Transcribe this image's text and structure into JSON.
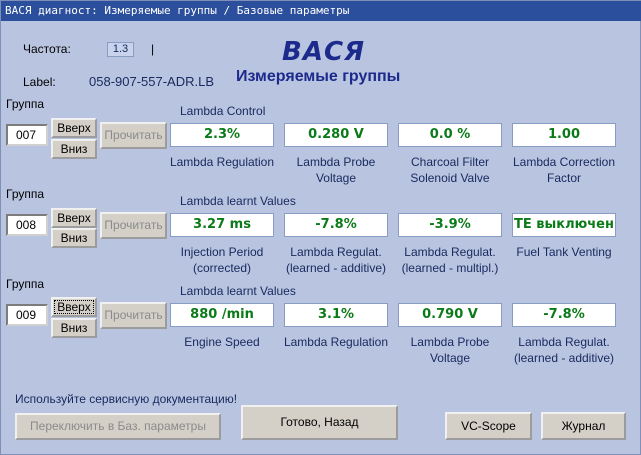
{
  "window": {
    "title": "ВАСЯ диагност: Измеряемые группы / Базовые параметры"
  },
  "header": {
    "freq_label": "Частота:",
    "freq_value": "1.3",
    "freq_unit": "|",
    "label_label": "Label:",
    "label_value": "058-907-557-ADR.LB",
    "brand": "ВАСЯ",
    "subtitle": "Измеряемые группы"
  },
  "groups": [
    {
      "group_label": "Группа",
      "number": "007",
      "up_label": "Вверх",
      "down_label": "Вниз",
      "read_label": "Прочитать",
      "section_title": "Lambda Control",
      "fields": [
        {
          "value": "2.3%",
          "desc": "Lambda Regulation"
        },
        {
          "value": "0.280 V",
          "desc": "Lambda Probe Voltage"
        },
        {
          "value": "0.0 %",
          "desc": "Charcoal Filter Solenoid Valve"
        },
        {
          "value": "1.00",
          "desc": "Lambda Correction Factor"
        }
      ]
    },
    {
      "group_label": "Группа",
      "number": "008",
      "up_label": "Вверх",
      "down_label": "Вниз",
      "read_label": "Прочитать",
      "section_title": "Lambda learnt Values",
      "fields": [
        {
          "value": "3.27 ms",
          "desc": "Injection Period (corrected)"
        },
        {
          "value": "-7.8%",
          "desc": "Lambda Regulat. (learned - additive)"
        },
        {
          "value": "-3.9%",
          "desc": "Lambda Regulat. (learned - multipl.)"
        },
        {
          "value": "TE выключен",
          "desc": "Fuel Tank Venting"
        }
      ]
    },
    {
      "group_label": "Группа",
      "number": "009",
      "up_label": "Вверх",
      "down_label": "Вниз",
      "read_label": "Прочитать",
      "section_title": "Lambda learnt Values",
      "fields": [
        {
          "value": "880 /min",
          "desc": "Engine Speed"
        },
        {
          "value": "3.1%",
          "desc": "Lambda Regulation"
        },
        {
          "value": "0.790 V",
          "desc": "Lambda Probe Voltage"
        },
        {
          "value": "-7.8%",
          "desc": "Lambda Regulat. (learned - additive)"
        }
      ]
    }
  ],
  "footer": {
    "note": "Используйте сервисную документацию!",
    "switch_label": "Переключить в Баз. параметры",
    "done_label": "Готово, Назад",
    "vcscope_label": "VC-Scope",
    "journal_label": "Журнал"
  },
  "colors": {
    "background": "#b9c5e0",
    "titlebar": "#2b4f9c",
    "value_text": "#0b7a18",
    "brand_text": "#1c2a8c"
  }
}
